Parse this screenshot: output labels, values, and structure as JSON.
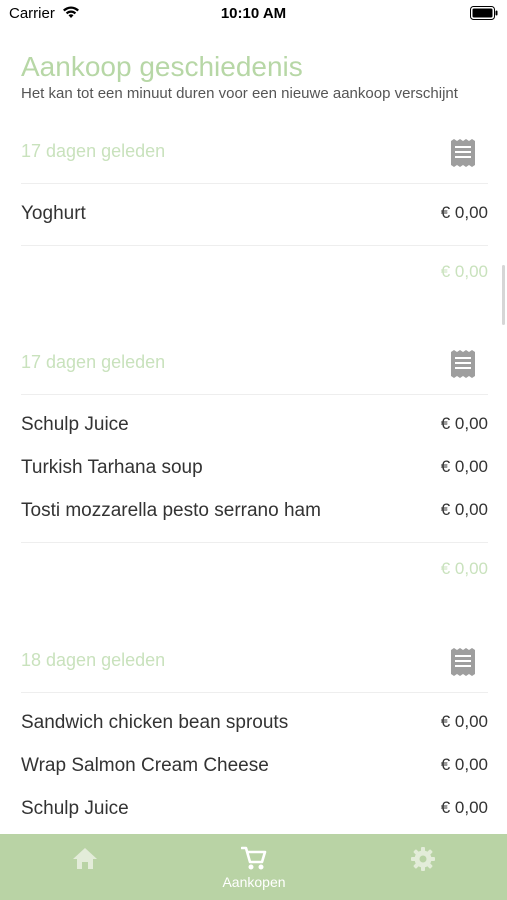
{
  "status_bar": {
    "carrier": "Carrier",
    "time": "10:10 AM"
  },
  "header": {
    "title": "Aankoop geschiedenis",
    "subtitle": "Het kan tot een minuut duren voor een nieuwe aankoop verschijnt"
  },
  "purchases": [
    {
      "date": "17 dagen geleden",
      "items": [
        {
          "name": "Yoghurt",
          "price": "€ 0,00"
        }
      ],
      "total": "€ 0,00"
    },
    {
      "date": "17 dagen geleden",
      "items": [
        {
          "name": "Schulp Juice",
          "price": "€ 0,00"
        },
        {
          "name": "Turkish Tarhana soup",
          "price": "€ 0,00"
        },
        {
          "name": "Tosti mozzarella pesto serrano ham",
          "price": "€ 0,00"
        }
      ],
      "total": "€ 0,00"
    },
    {
      "date": "18 dagen geleden",
      "items": [
        {
          "name": "Sandwich chicken bean sprouts",
          "price": "€ 0,00"
        },
        {
          "name": "Wrap Salmon Cream Cheese",
          "price": "€ 0,00"
        },
        {
          "name": "Schulp Juice",
          "price": "€ 0,00"
        }
      ],
      "total": ""
    }
  ],
  "tab_bar": {
    "tabs": [
      {
        "icon": "home-icon",
        "label": ""
      },
      {
        "icon": "cart-icon",
        "label": "Aankopen"
      },
      {
        "icon": "gear-icon",
        "label": ""
      }
    ],
    "active_index": 1
  },
  "colors": {
    "accent_light": "#c9e2bd",
    "title_green": "#b7d7a6",
    "tab_bar_bg": "#b9d3a5",
    "icon_gray": "#9e9e9e"
  }
}
